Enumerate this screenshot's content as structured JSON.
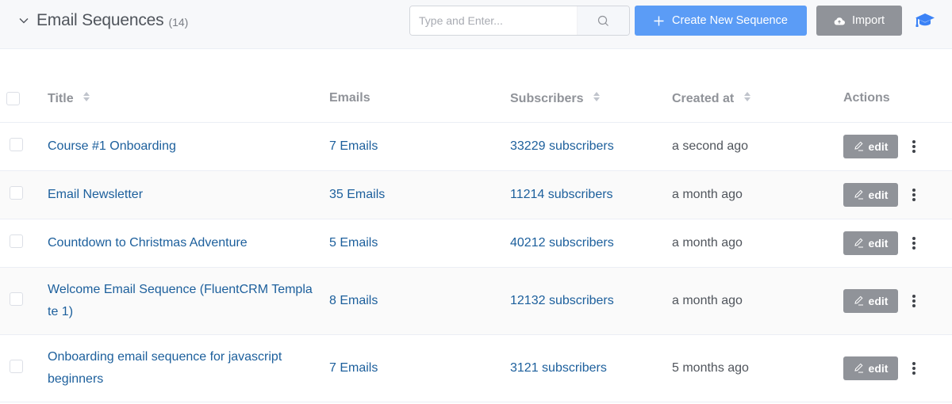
{
  "header": {
    "title": "Email Sequences",
    "count": "(14)",
    "collapse_icon": "chevron-down-icon",
    "search": {
      "placeholder": "Type and Enter...",
      "value": "",
      "icon": "search-icon"
    },
    "create_button": {
      "label": "Create New Sequence",
      "icon": "plus-icon",
      "color": "#5b9cf6"
    },
    "import_button": {
      "label": "Import",
      "icon": "cloud-upload-icon",
      "color": "#909399"
    },
    "help_icon": "graduation-cap-icon"
  },
  "table": {
    "columns": [
      {
        "key": "title",
        "label": "Title",
        "sortable": true
      },
      {
        "key": "emails",
        "label": "Emails",
        "sortable": false
      },
      {
        "key": "subscribers",
        "label": "Subscribers",
        "sortable": true
      },
      {
        "key": "created_at",
        "label": "Created at",
        "sortable": true
      },
      {
        "key": "actions",
        "label": "Actions",
        "sortable": false
      }
    ],
    "rows": [
      {
        "title": "Course #1 Onboarding",
        "emails": "7 Emails",
        "subscribers": "33229 subscribers",
        "created_at": "a second ago",
        "edit_label": "edit"
      },
      {
        "title": "Email Newsletter",
        "emails": "35 Emails",
        "subscribers": "11214 subscribers",
        "created_at": "a month ago",
        "edit_label": "edit"
      },
      {
        "title": "Countdown to Christmas Adventure",
        "emails": "5 Emails",
        "subscribers": "40212 subscribers",
        "created_at": "a month ago",
        "edit_label": "edit"
      },
      {
        "title": "Welcome Email Sequence (FluentCRM Template 1)",
        "emails": "8 Emails",
        "subscribers": "12132 subscribers",
        "created_at": "a month ago",
        "edit_label": "edit"
      },
      {
        "title": "Onboarding email sequence for javascript beginners",
        "emails": "7 Emails",
        "subscribers": "3121 subscribers",
        "created_at": "5 months ago",
        "edit_label": "edit"
      }
    ]
  },
  "colors": {
    "link": "#1c5f9c",
    "primary": "#5b9cf6",
    "secondary": "#909399"
  }
}
